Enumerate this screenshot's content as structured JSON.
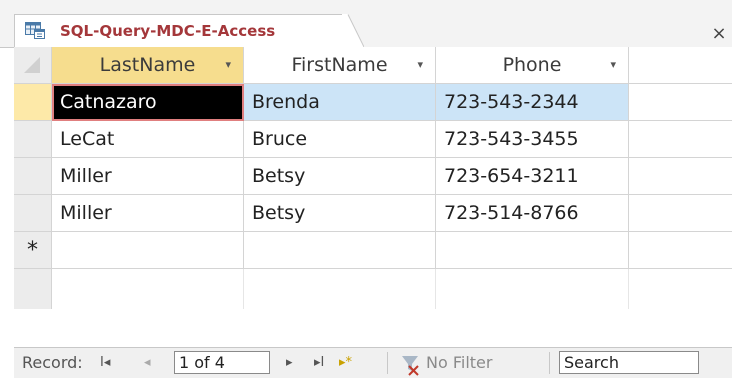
{
  "tab": {
    "title": "SQL-Query-MDC-E-Access",
    "icon": "query-datasheet-icon",
    "close_label": "×"
  },
  "columns": [
    {
      "label": "LastName",
      "arrow": "▾"
    },
    {
      "label": "FirstName",
      "arrow": "▾"
    },
    {
      "label": "Phone",
      "arrow": "▾"
    }
  ],
  "rows": [
    {
      "last": "Catnazaro",
      "first": "Brenda",
      "phone": "723-543-2344"
    },
    {
      "last": "LeCat",
      "first": "Bruce",
      "phone": "723-543-3455"
    },
    {
      "last": "Miller",
      "first": "Betsy",
      "phone": "723-654-3211"
    },
    {
      "last": "Miller",
      "first": "Betsy",
      "phone": "723-514-8766"
    }
  ],
  "new_row_marker": "*",
  "navbar": {
    "record_label": "Record:",
    "first_glyph": "I◂",
    "prev_glyph": "◂",
    "record_position": "1 of 4",
    "next_glyph": "▸",
    "last_glyph": "▸I",
    "new_glyph": "▸*",
    "filter_label": "No Filter",
    "search_value": "Search"
  },
  "colors": {
    "title_color": "#a4373a",
    "selected_row": "#cce4f7",
    "active_cell": "#000000"
  }
}
